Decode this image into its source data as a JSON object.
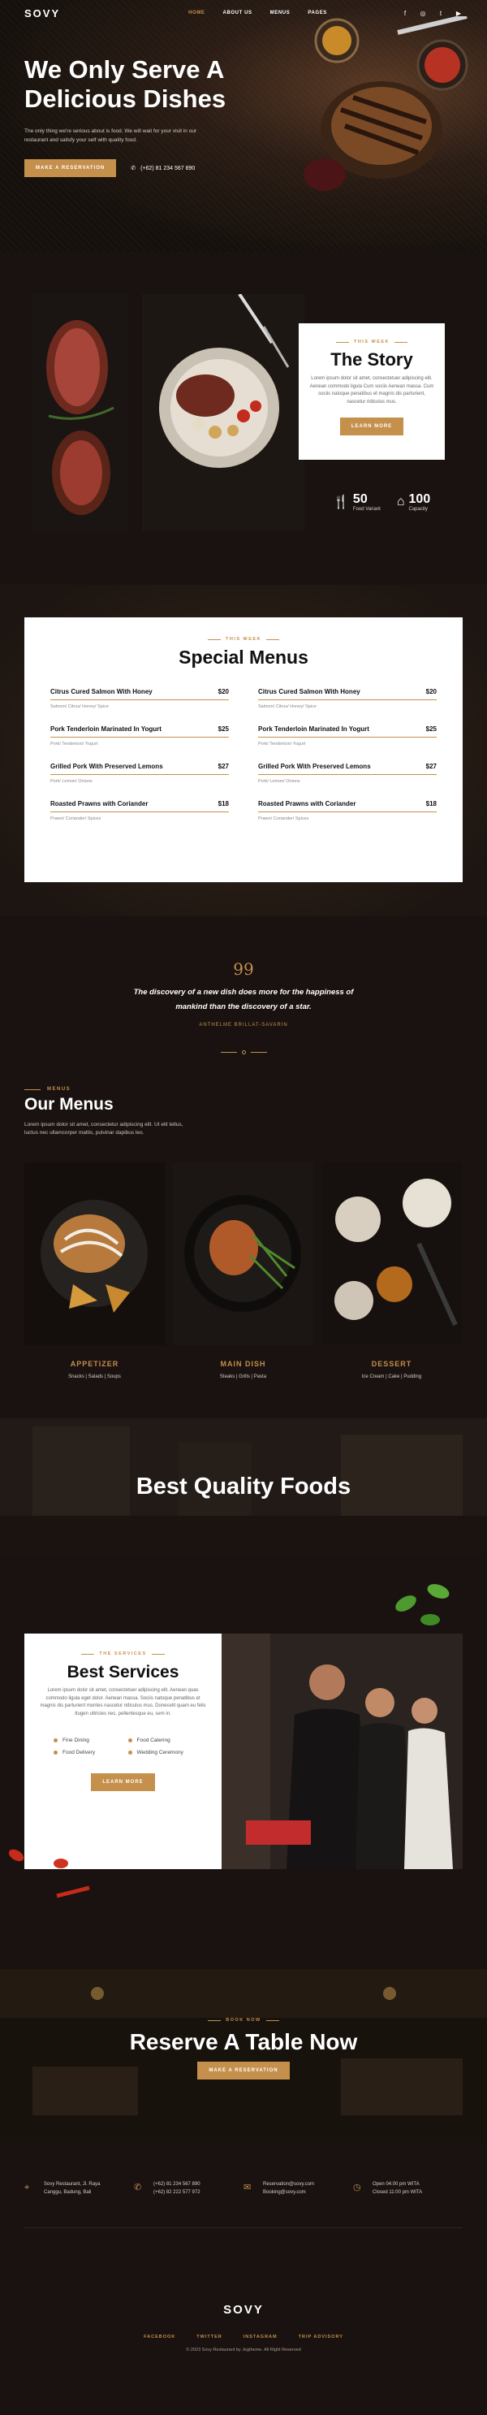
{
  "nav": {
    "logo": "SOVY",
    "items": [
      "HOME",
      "ABOUT US",
      "MENUS",
      "PAGES"
    ],
    "social": [
      "facebook-icon",
      "instagram-icon",
      "twitter-icon",
      "youtube-icon"
    ]
  },
  "hero": {
    "title_line1": "We Only Serve A",
    "title_line2": "Delicious Dishes",
    "subtitle": "The only thing we're serious about is food. We will wait for your visit in our restaurant and satisfy your self with quality food.",
    "cta": "MAKE A RESERVATION",
    "phone": "(+62) 81 234 567 890"
  },
  "story": {
    "eyebrow": "THIS WEEK",
    "title": "The Story",
    "text": "Lorem ipsum dolor sit amet, consectetuer adipiscing elit. Aenean commodo ligula Cum sociis Aenean massa. Cum sociis natoque penatibus et magnis dis parturient, nascetur ridiculus mus.",
    "cta": "LEARN MORE",
    "stats": [
      {
        "num": "50",
        "label": "Food Variant"
      },
      {
        "num": "100",
        "label": "Capacity"
      }
    ]
  },
  "special": {
    "eyebrow": "THIS WEEK",
    "title": "Special Menus",
    "items": [
      {
        "name": "Citrus Cured Salmon With Honey",
        "price": "$20",
        "desc": "Salmon/ Citrus/ Honey/ Spice"
      },
      {
        "name": "Citrus Cured Salmon With Honey",
        "price": "$20",
        "desc": "Salmon/ Citrus/ Honey/ Spice"
      },
      {
        "name": "Pork Tenderloin Marinated In Yogurt",
        "price": "$25",
        "desc": "Pork/ Tenderloin/ Yogurt"
      },
      {
        "name": "Pork Tenderloin Marinated In Yogurt",
        "price": "$25",
        "desc": "Pork/ Tenderloin/ Yogurt"
      },
      {
        "name": "Grilled Pork With Preserved Lemons",
        "price": "$27",
        "desc": "Pork/ Lemon/ Onions"
      },
      {
        "name": "Grilled Pork With Preserved Lemons",
        "price": "$27",
        "desc": "Pork/ Lemon/ Onions"
      },
      {
        "name": "Roasted Prawns with Coriander",
        "price": "$18",
        "desc": "Prawn/ Coriander/ Spices"
      },
      {
        "name": "Roasted Prawns with Coriander",
        "price": "$18",
        "desc": "Prawn/ Coriander/ Spices"
      }
    ]
  },
  "quote": {
    "mark": "99",
    "text": "The discovery of a new dish does more for the happiness of mankind than the discovery of a star.",
    "author": "ANTHELME BRILLAT-SAVARIN"
  },
  "ourmenus": {
    "eyebrow": "MENUS",
    "title": "Our Menus",
    "text": "Lorem ipsum dolor sit amet, consectetur adipiscing elit. Ut elit tellus, luctus nec ullamcorper mattis, pulvinar dapibus leo.",
    "categories": [
      {
        "name": "APPETIZER",
        "sub": "Snacks | Salads | Soups"
      },
      {
        "name": "MAIN DISH",
        "sub": "Steaks | Grills | Pasta"
      },
      {
        "name": "DESSERT",
        "sub": "Ice Cream | Cake | Pudding"
      }
    ]
  },
  "quality": {
    "title": "Best Quality Foods"
  },
  "services": {
    "eyebrow": "THE SERVICES",
    "title": "Best Services",
    "text": "Lorem ipsum dolor sit amet, consectetuer adipiscing elit. Aenean quas commodo ligula eget dolor. Aenean massa. Sociis natoque penatibus et magnis dis parturient montes nascetur ridiculus mus. Donecelit quam eu felis ttugen ultricies nec, pellentesque eu, sem in.",
    "list": [
      "Fine Dining",
      "Food Catering",
      "Food Delivery",
      "Wedding Ceremony"
    ],
    "cta": "LEARN MORE"
  },
  "reserve": {
    "eyebrow": "BOOK NOW",
    "title": "Reserve A Table Now",
    "cta": "MAKE A RESERVATION"
  },
  "footer": {
    "address": [
      "Sovy Restaurant, Jl. Raya",
      "Canggu, Badung, Bali"
    ],
    "phones": [
      "(+62) 81 234 567 890",
      "(+62) 82 222 577 972"
    ],
    "emails": [
      "Reservation@sovy.com",
      "Booking@sovy.com"
    ],
    "hours": [
      "Open 04:00 pm WITA",
      "Closed 11:00 pm WITA"
    ],
    "logo": "SOVY",
    "links": [
      "FACEBOOK",
      "TWITTER",
      "INSTAGRAM",
      "TRIP ADVISORY"
    ],
    "copyright": "© 2023 Sovy Restaurant by Jegtheme. All Right Reserved"
  },
  "colors": {
    "accent": "#c58f4c",
    "dark": "#1a1210",
    "card": "#ffffff"
  }
}
